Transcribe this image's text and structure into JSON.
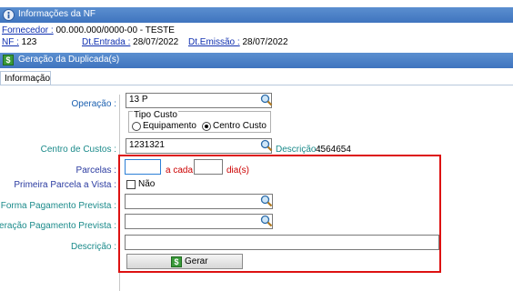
{
  "nf_header": {
    "title": "Informações da NF"
  },
  "nf_info": {
    "fornecedor_label": "Fornecedor :",
    "fornecedor_value": "00.000.000/0000-00 - TESTE",
    "nf_label": "NF :",
    "nf_value": "123",
    "dt_entrada_label": "Dt.Entrada :",
    "dt_entrada_value": "28/07/2022",
    "dt_emissao_label": "Dt.Emissão :",
    "dt_emissao_value": "28/07/2022"
  },
  "dup_header": {
    "title": "Geração da Duplicada(s)",
    "icon": "dollar-icon"
  },
  "tabs": [
    {
      "label": "Informação"
    }
  ],
  "form": {
    "operacao_label": "Operação :",
    "operacao_value": "13 P",
    "tipo_custo_label": "Tipo Custo",
    "tipo_custo_options": [
      "Equipamento",
      "Centro Custo"
    ],
    "tipo_custo_selected": "Centro Custo",
    "centro_label": "Centro de Custos :",
    "centro_value": "1231321",
    "descricao_cc_label": "Descrição :",
    "descricao_cc_value": "4564654",
    "parcelas_label": "Parcelas :",
    "parcelas_value": "",
    "a_cada_label": "a cada",
    "dias_value": "",
    "dias_label": "dia(s)",
    "primeira_label": "Primeira Parcela a Vista :",
    "primeira_check_label": "Não",
    "forma_label": "Forma Pagamento Prevista :",
    "forma_value": "",
    "op_pag_label": "Operação Pagamento Prevista :",
    "op_pag_value": "",
    "descricao_label": "Descrição :",
    "descricao_value": "",
    "gerar_label": "Gerar"
  },
  "colors": {
    "header_blue": "#4a80c8",
    "label_blue": "#1a5fb0",
    "label_teal": "#1a8a8a",
    "highlight_red": "#dd1111"
  }
}
